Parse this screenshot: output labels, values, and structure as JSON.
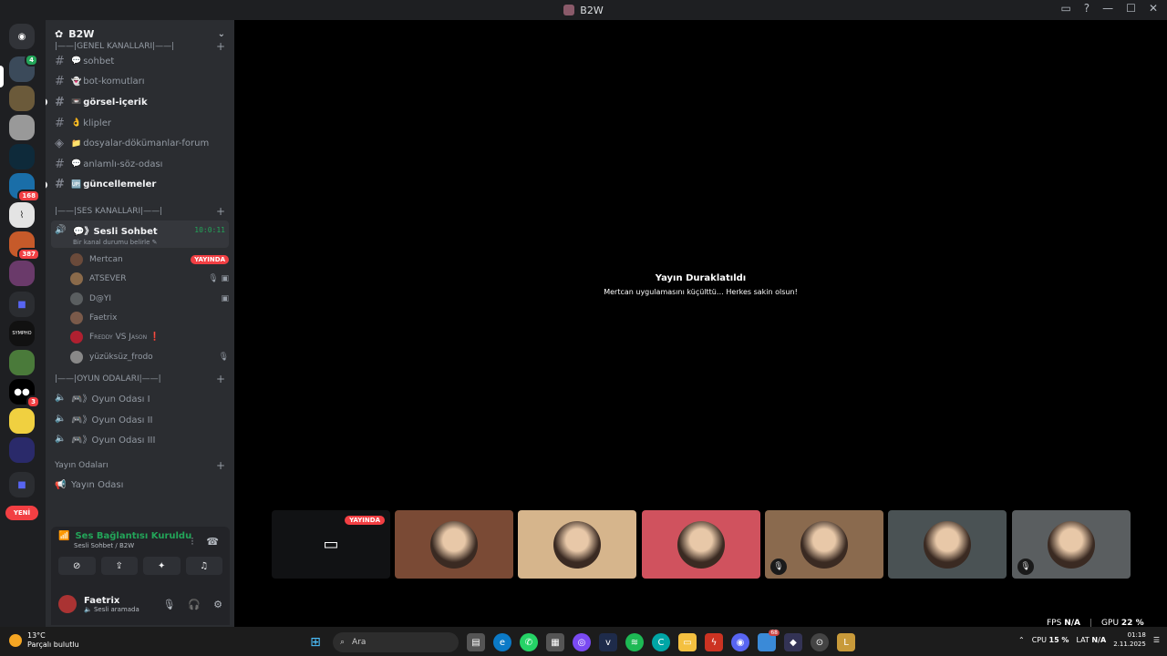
{
  "window": {
    "title": "B2W"
  },
  "guild": {
    "name": "B2W"
  },
  "categories": {
    "general": "|——|GENEL KANALLARI|——|",
    "voice": "|——|SES KANALLARI|——|",
    "games": "|——|OYUN ODALARI|——|",
    "streams": "Yayın Odaları"
  },
  "text_channels": [
    {
      "emoji": "💬",
      "name": "sohbet",
      "unread": false
    },
    {
      "emoji": "👻",
      "name": "bot-komutları",
      "unread": false
    },
    {
      "emoji": "📼",
      "name": "görsel-içerik",
      "unread": true
    },
    {
      "emoji": "👌",
      "name": "klipler",
      "unread": false
    },
    {
      "emoji": "📁",
      "name": "dosyalar-dökümanlar-forum",
      "unread": false
    },
    {
      "emoji": "💬",
      "name": "anlamlı-söz-odası",
      "unread": false
    },
    {
      "emoji": "🆙",
      "name": "güncellemeler",
      "unread": true
    }
  ],
  "active_voice": {
    "name": "💬》Sesli Sohbet",
    "timer": "10:0:11",
    "status_placeholder": "Bir kanal durumu belirle"
  },
  "voice_users": [
    {
      "name": "Mertcan",
      "live": "YAYINDA"
    },
    {
      "name": "ATSEVER",
      "icons": "🎙 ▣"
    },
    {
      "name": "D@YI",
      "icons": "▣"
    },
    {
      "name": "Faetrix"
    },
    {
      "name": "Freddy VS Jason ❗"
    },
    {
      "name": "yüzüksüz_frodo",
      "icons": "🎙"
    }
  ],
  "game_rooms": [
    "🎮》Oyun Odası I",
    "🎮》Oyun Odası II",
    "🎮》Oyun Odası III"
  ],
  "stream_room": "Yayın Odası",
  "new_badge": "YENİ",
  "server_badges": [
    "4",
    "168",
    "387",
    "3"
  ],
  "voice_panel": {
    "title": "Ses Bağlantısı Kuruldu",
    "sub": "Sesli Sohbet / B2W"
  },
  "user": {
    "name": "Faetrix",
    "status": "Sesli aramada"
  },
  "stage": {
    "paused_title": "Yayın Duraklatıldı",
    "paused_msg": "Mertcan uygulamasını küçülttü… Herkes sakin olsun!",
    "live_badge": "YAYINDA"
  },
  "tiles": [
    {
      "bg": "#111214",
      "kind": "screen",
      "live": true
    },
    {
      "bg": "#7a4a35",
      "kind": "avatar"
    },
    {
      "bg": "#d6b58c",
      "kind": "avatar"
    },
    {
      "bg": "#d0525e",
      "kind": "avatar"
    },
    {
      "bg": "#8a6a4e",
      "kind": "avatar",
      "muted": true
    },
    {
      "bg": "#4a5254",
      "kind": "avatar"
    },
    {
      "bg": "#5a5e60",
      "kind": "avatar",
      "muted": true
    }
  ],
  "perf": {
    "fps_label": "FPS",
    "fps": "N/A",
    "gpu_label": "GPU",
    "gpu": "22 %",
    "cpu_label": "CPU",
    "cpu": "15 %",
    "lat_label": "LAT",
    "lat": "N/A"
  },
  "taskbar": {
    "temp": "13°C",
    "weather": "Parçalı bulutlu",
    "search": "Ara",
    "time": "01:18",
    "date": "2.11.2025",
    "badge_a": "68"
  },
  "colors": {
    "accent_green": "#23a559",
    "live_red": "#f23f43",
    "sidebar": "#2b2d31",
    "rail": "#1e1f22"
  }
}
